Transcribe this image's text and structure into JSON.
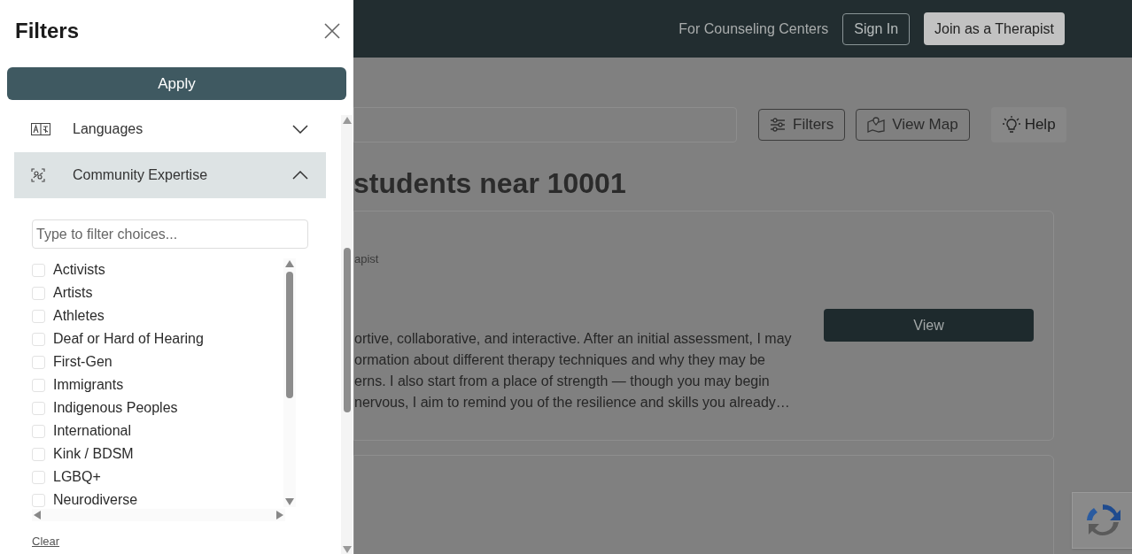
{
  "page": {
    "nav_link": "For Counseling Centers",
    "sign_in": "Sign In",
    "join": "Join as a Therapist",
    "toolbar": [
      {
        "kind": "filters",
        "label": "Filters"
      },
      {
        "kind": "map",
        "label": "View Map"
      },
      {
        "kind": "help",
        "label": "Help"
      }
    ],
    "heading": "students near 10001",
    "card": {
      "subtitle": "apist",
      "description": [
        "ortive, collaborative, and interactive. After an initial assessment, I may",
        "ormation about different therapy techniques and why they may be",
        "erns. I also start from a place of strength — though you may begin",
        "nervous, I aim to remind you of the resilience and skills you already…"
      ],
      "button": "View"
    }
  },
  "drawer": {
    "title": "Filters",
    "apply": "Apply",
    "sections": [
      {
        "kind": "languages",
        "label": "Languages",
        "expanded": false
      },
      {
        "kind": "community",
        "label": "Community Expertise",
        "expanded": true
      }
    ],
    "filter_placeholder": "Type to filter choices...",
    "options": [
      {
        "label": "Activists",
        "checked": false
      },
      {
        "label": "Artists",
        "checked": false
      },
      {
        "label": "Athletes",
        "checked": false
      },
      {
        "label": "Deaf or Hard of Hearing",
        "checked": false
      },
      {
        "label": "First-Gen",
        "checked": false
      },
      {
        "label": "Immigrants",
        "checked": false
      },
      {
        "label": "Indigenous Peoples",
        "checked": false
      },
      {
        "label": "International",
        "checked": false
      },
      {
        "label": "Kink / BDSM",
        "checked": false
      },
      {
        "label": "LGBQ+",
        "checked": false
      },
      {
        "label": "Neurodiverse",
        "checked": false
      }
    ],
    "clear": "Clear"
  }
}
